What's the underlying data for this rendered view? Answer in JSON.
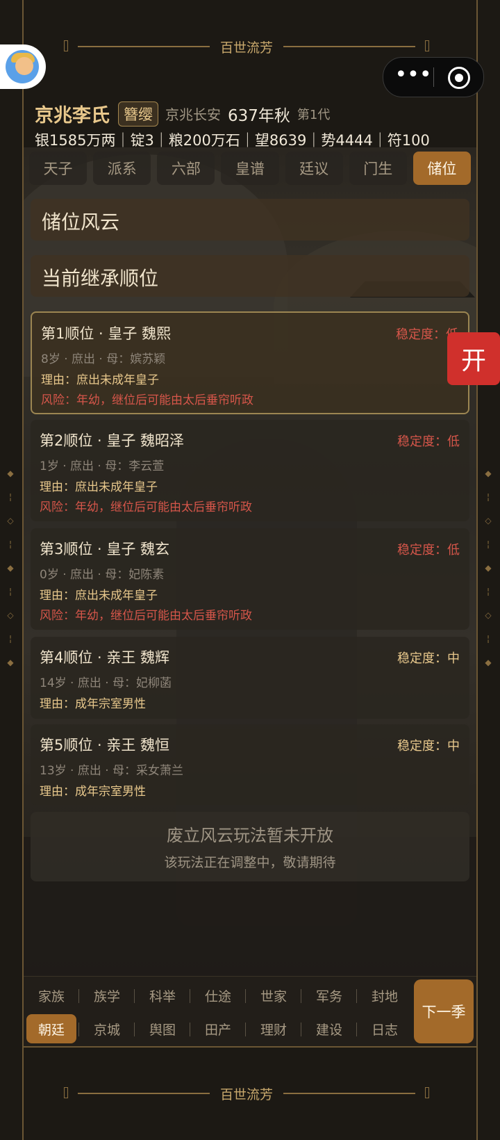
{
  "banner_title": "百世流芳",
  "header": {
    "clan": "京兆李氏",
    "badge": "簪缨",
    "location": "京兆长安",
    "year": "637年秋",
    "generation": "第1代",
    "stats": "银1585万两｜锭3｜粮200万石｜望8639｜势4444｜符100"
  },
  "tabs": [
    {
      "label": "天子",
      "active": false
    },
    {
      "label": "派系",
      "active": false
    },
    {
      "label": "六部",
      "active": false
    },
    {
      "label": "皇谱",
      "active": false
    },
    {
      "label": "廷议",
      "active": false
    },
    {
      "label": "门生",
      "active": false
    },
    {
      "label": "储位",
      "active": true
    }
  ],
  "section_title": "储位风云",
  "subsection_title": "当前继承顺位",
  "candidates": [
    {
      "title": "第1顺位 · 皇子 魏熙",
      "stability": "稳定度：低",
      "info": "8岁 · 庶出 · 母：嫔苏颖",
      "reason": "理由：庶出未成年皇子",
      "risk": "风险：年幼，继位后可能由太后垂帘听政"
    },
    {
      "title": "第2顺位 · 皇子 魏昭泽",
      "stability": "稳定度：低",
      "info": "1岁 · 庶出 · 母：李云萱",
      "reason": "理由：庶出未成年皇子",
      "risk": "风险：年幼，继位后可能由太后垂帘听政"
    },
    {
      "title": "第3顺位 · 皇子 魏玄",
      "stability": "稳定度：低",
      "info": "0岁 · 庶出 · 母：妃陈素",
      "reason": "理由：庶出未成年皇子",
      "risk": "风险：年幼，继位后可能由太后垂帘听政"
    },
    {
      "title": "第4顺位 · 亲王 魏辉",
      "stability": "稳定度：中",
      "info": "14岁 · 庶出 · 母：妃柳菡",
      "reason": "理由：成年宗室男性",
      "risk": ""
    },
    {
      "title": "第5顺位 · 亲王 魏恒",
      "stability": "稳定度：中",
      "info": "13岁 · 庶出 · 母：采女萧兰",
      "reason": "理由：成年宗室男性",
      "risk": ""
    }
  ],
  "notice": {
    "title": "废立风云玩法暂未开放",
    "subtitle": "该玩法正在调整中，敬请期待"
  },
  "open_button": "开",
  "bottom_nav": {
    "row1": [
      "家族",
      "族学",
      "科举",
      "仕途",
      "世家",
      "军务",
      "封地"
    ],
    "row2": [
      "朝廷",
      "京城",
      "舆图",
      "田产",
      "理财",
      "建设",
      "日志"
    ],
    "active": "朝廷",
    "next_button": "下一季"
  },
  "colors": {
    "accent": "#a36a2a",
    "gold": "#e8c88c",
    "risk_red": "#d6564a",
    "open_red": "#d0302c"
  }
}
